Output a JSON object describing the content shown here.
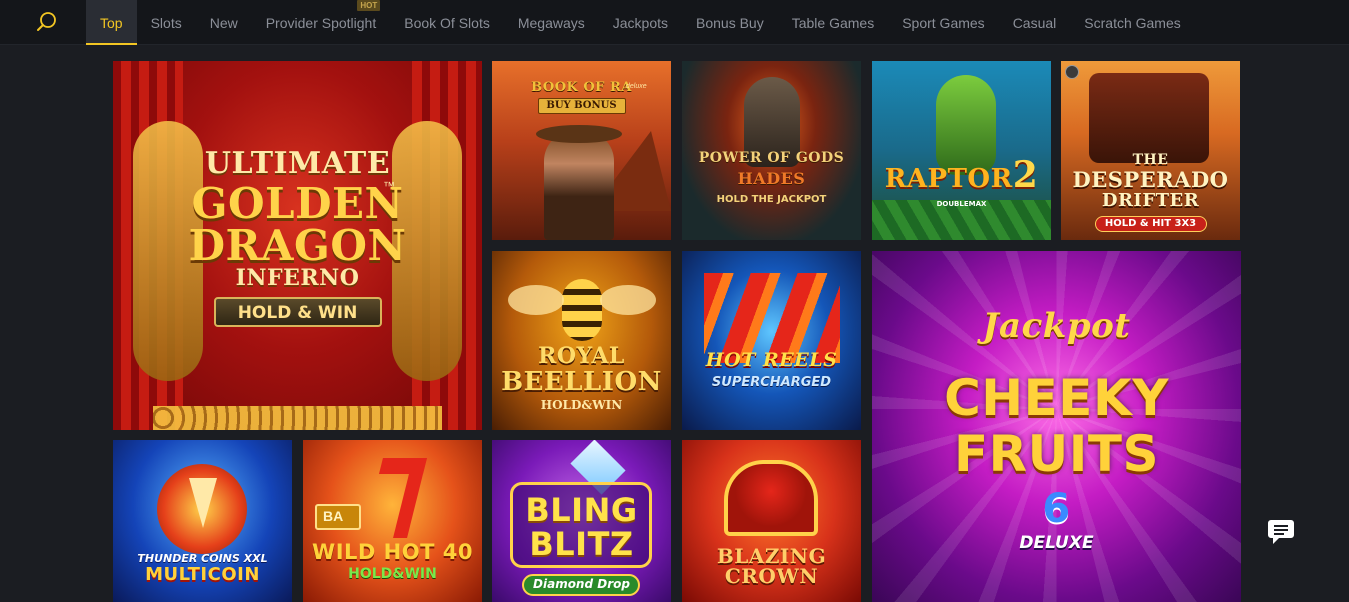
{
  "nav": {
    "tabs": [
      {
        "label": "Top",
        "active": true
      },
      {
        "label": "Slots"
      },
      {
        "label": "New"
      },
      {
        "label": "Provider Spotlight",
        "badge": "HOT"
      },
      {
        "label": "Book Of Slots"
      },
      {
        "label": "Megaways"
      },
      {
        "label": "Jackpots"
      },
      {
        "label": "Bonus Buy"
      },
      {
        "label": "Table Games"
      },
      {
        "label": "Sport Games"
      },
      {
        "label": "Casual"
      },
      {
        "label": "Scratch Games"
      }
    ]
  },
  "games": {
    "golden_dragon": {
      "line1": "ULTIMATE",
      "line2": "GOLDEN",
      "line3": "DRAGON",
      "line4": "INFERNO",
      "tm": "™",
      "sub": "HOLD & WIN"
    },
    "book_of_ra": {
      "line1": "BOOK OF RA",
      "tag": "deluxe",
      "sub": "BUY BONUS"
    },
    "power_of_gods": {
      "line1": "POWER OF GODS",
      "line2": "HADES",
      "sub": "HOLD THE JACKPOT"
    },
    "raptor": {
      "line1": "RAPTOR",
      "num": "2",
      "sub": "DOUBLEMAX"
    },
    "desperado": {
      "line1": "THE",
      "line2": "DESPERADO",
      "line3": "DRIFTER",
      "sub": "HOLD & HIT 3x3"
    },
    "royal_beellion": {
      "line1": "ROYAL",
      "line2": "BEELLION",
      "sub": "HOLD&WIN"
    },
    "hot_reels": {
      "line1": "HOT REELS",
      "sub": "SUPERCHARGED"
    },
    "cheeky_fruits": {
      "line1": "Jackpot",
      "line2": "CHEEKY",
      "line3": "FRUITS",
      "num": "6",
      "sub": "DELUXE"
    },
    "thunder_coins": {
      "line1": "THUNDER COINS XXL",
      "sub": "MULTICOIN"
    },
    "wild_hot": {
      "line0": "BA",
      "line1": "WILD HOT 40",
      "sub": "HOLD&WIN"
    },
    "bling_blitz": {
      "line1": "BLING",
      "line2": "BLITZ",
      "sub": "Diamond Drop"
    },
    "blazing_crown": {
      "line1": "BLAZING",
      "line2": "CROWN"
    }
  },
  "colors": {
    "accent": "#f3c623",
    "nav_bg": "#14161a",
    "page_bg": "#1b1d22"
  }
}
